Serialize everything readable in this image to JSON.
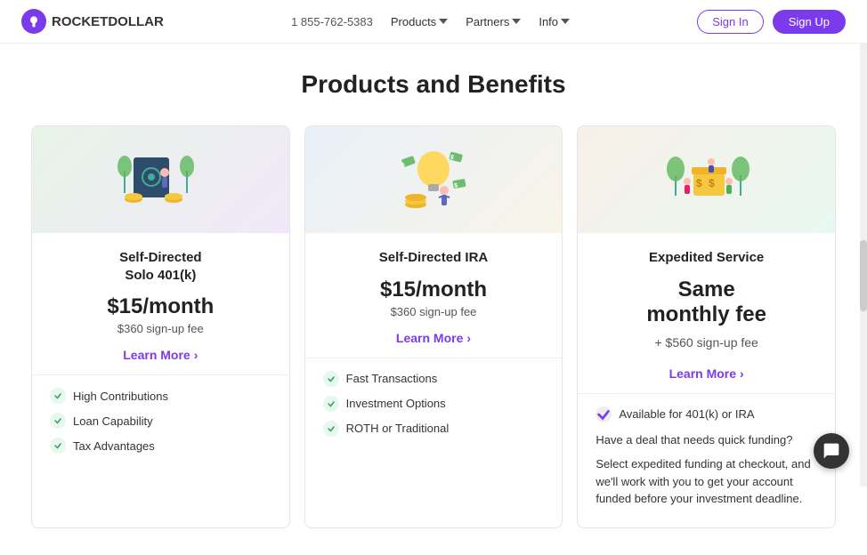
{
  "navbar": {
    "logo_text": "ROCKETDOLLAR",
    "phone": "1 855-762-5383",
    "nav_items": [
      {
        "label": "Products",
        "has_dropdown": true
      },
      {
        "label": "Partners",
        "has_dropdown": true
      },
      {
        "label": "Info",
        "has_dropdown": true
      }
    ],
    "signin_label": "Sign In",
    "signup_label": "Sign Up"
  },
  "page": {
    "title": "Products and Benefits"
  },
  "cards": [
    {
      "id": "solo-401k",
      "title": "Self-Directed\nSolo 401(k)",
      "price": "$15/month",
      "signup_fee": "$360 sign-up fee",
      "learn_more_label": "Learn More",
      "features": [
        {
          "label": "High Contributions"
        },
        {
          "label": "Loan Capability"
        },
        {
          "label": "Tax Advantages"
        }
      ]
    },
    {
      "id": "ira",
      "title": "Self-Directed IRA",
      "price": "$15/month",
      "signup_fee": "$360 sign-up fee",
      "learn_more_label": "Learn More",
      "features": [
        {
          "label": "Fast Transactions"
        },
        {
          "label": "Investment Options"
        },
        {
          "label": "ROTH or Traditional"
        }
      ]
    },
    {
      "id": "expedited",
      "title": "Expedited Service",
      "price_line1": "Same",
      "price_line2": "monthly fee",
      "price_line3": "+ $560 sign-up fee",
      "learn_more_label": "Learn More",
      "description1": "Available for 401(k) or IRA",
      "description2": "Have a deal that needs quick funding?",
      "description3": "Select expedited funding at checkout, and we'll work with you to get your account funded before your investment deadline."
    }
  ]
}
